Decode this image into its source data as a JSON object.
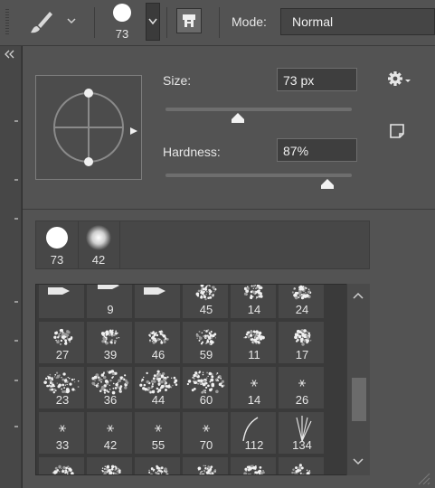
{
  "options_bar": {
    "tool_icon": "brush-icon",
    "brush_size": "73",
    "mode_label": "Mode:",
    "mode_value": "Normal",
    "brush_settings_icon": "brush-settings-icon"
  },
  "picker": {
    "size_label": "Size:",
    "size_value": "73 px",
    "size_fraction": 0.39,
    "hardness_label": "Hardness:",
    "hardness_value": "87%",
    "hardness_fraction": 0.87,
    "gear_icon": "gear-icon",
    "new_preset_icon": "new-preset-icon"
  },
  "recent_brushes": [
    {
      "label": "73",
      "kind": "hard-round"
    },
    {
      "label": "42",
      "kind": "soft-round"
    }
  ],
  "preset_rows": [
    [
      "",
      "9",
      "",
      "45",
      "14",
      "24"
    ],
    [
      "27",
      "39",
      "46",
      "59",
      "11",
      "17"
    ],
    [
      "23",
      "36",
      "44",
      "60",
      "14",
      "26"
    ],
    [
      "33",
      "42",
      "55",
      "70",
      "112",
      "134"
    ],
    [
      "",
      "",
      "",
      "",
      "",
      ""
    ]
  ],
  "colors": {
    "panel": "#535353",
    "input_bg": "#3e3e3e",
    "grid_bg": "#3a3a3a"
  }
}
